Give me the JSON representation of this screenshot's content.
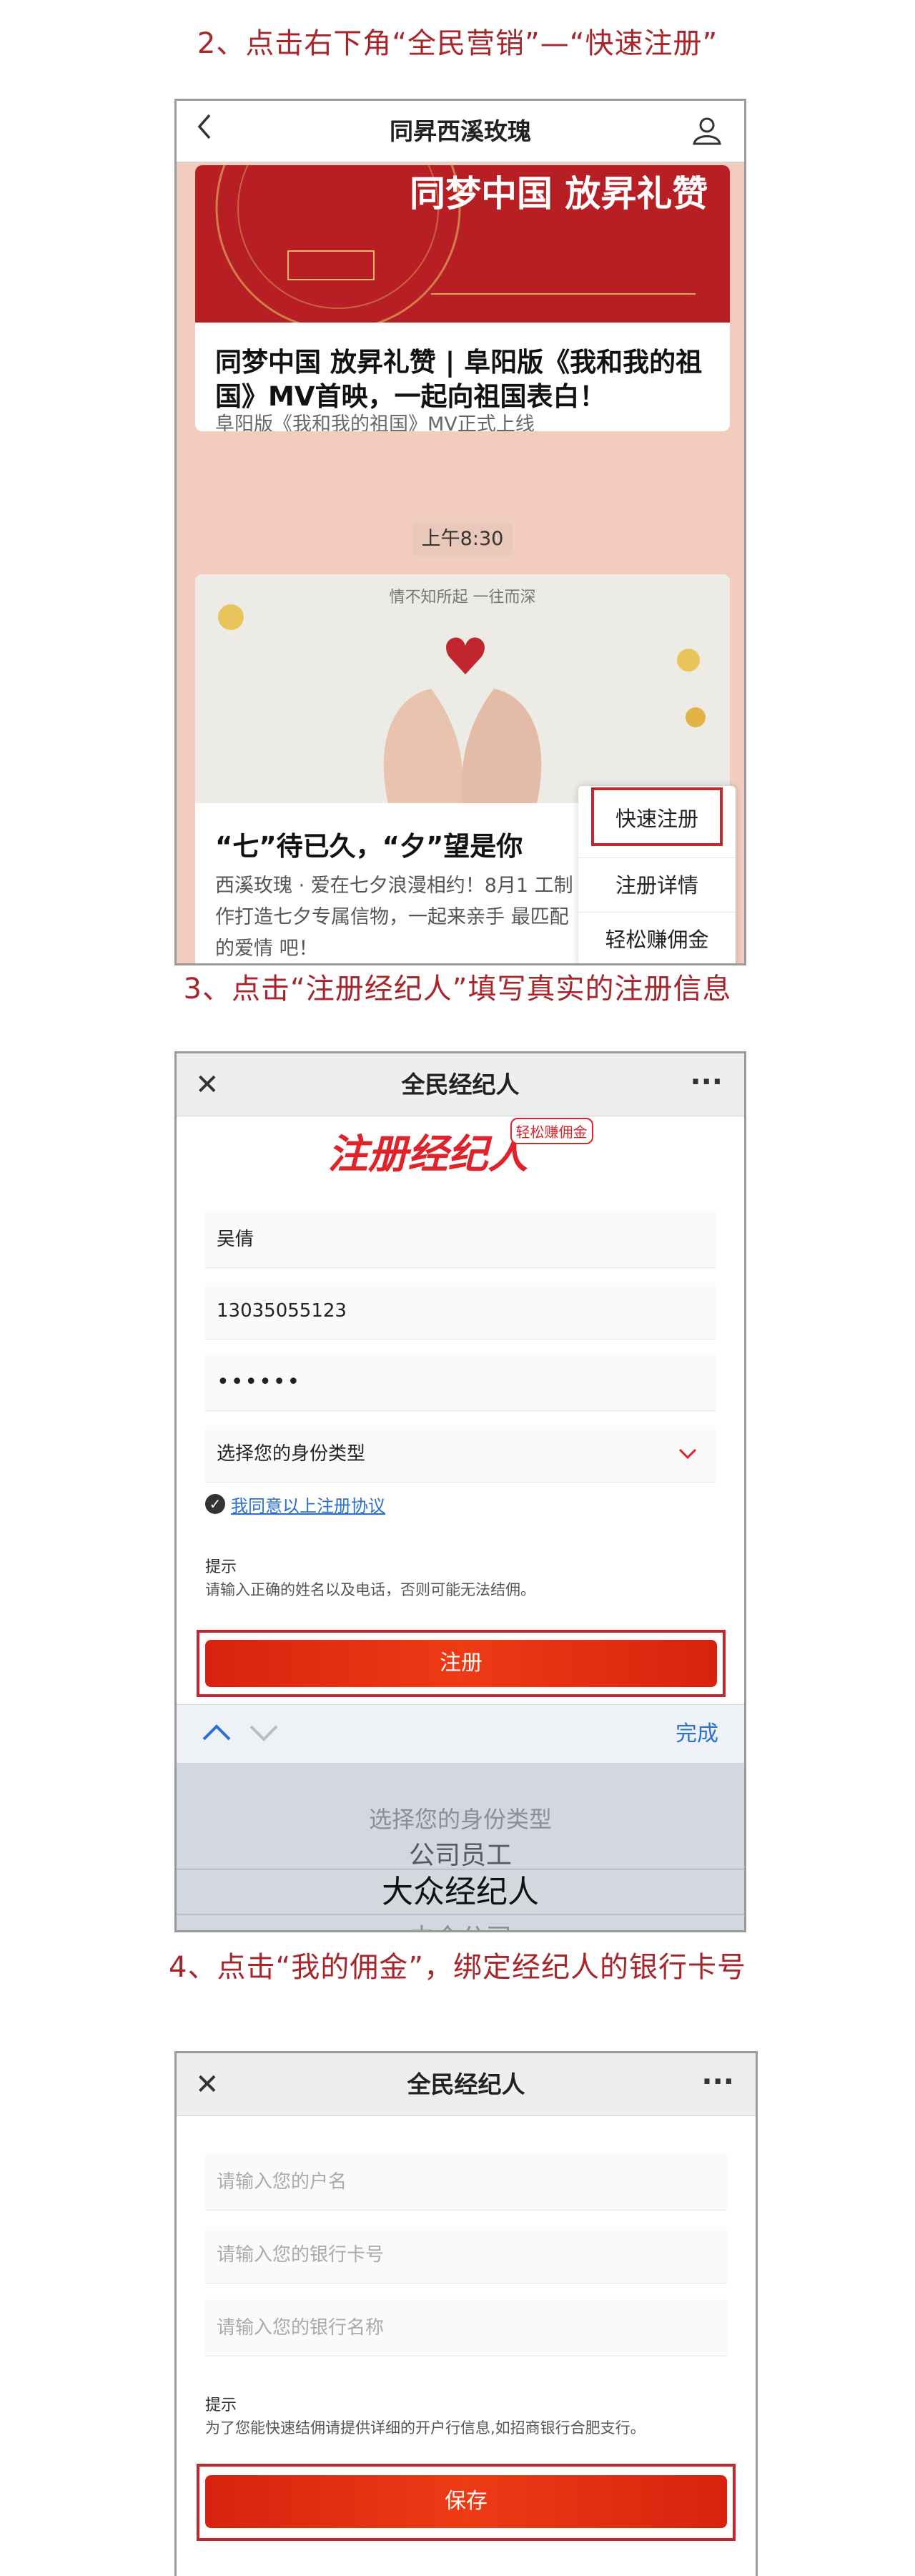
{
  "step2": {
    "title": "2、点击右下角“全民营销”—“快速注册”",
    "header": {
      "back_icon": "chevron-left-icon",
      "title": "同昇西溪玫瑰",
      "profile_icon": "user-icon"
    },
    "banner": {
      "headline": "同梦中国  放昇礼赞"
    },
    "article1": {
      "title": "同梦中国 放昇礼赞 | 阜阳版《我和我的祖国》MV首映，一起向祖国表白！",
      "subtitle": "阜阳版《我和我的祖国》MV正式上线"
    },
    "time_label": "上午8:30",
    "article2": {
      "image_caption": "情不知所起 一往而深",
      "title": "“七”待已久，“夕”望是你",
      "desc": "西溪玫瑰 · 爱在七夕浪漫相约！8月1 工制作打造七夕专属信物，一起来亲手 最匹配的爱情 吧！"
    },
    "popup_menu": [
      "快速注册",
      "注册详情",
      "轻松赚佣金"
    ]
  },
  "step3": {
    "title": "3、点击“注册经纪人”填写真实的注册信息",
    "header": {
      "close_icon": "close-icon",
      "title": "全民经纪人",
      "more_icon": "more-icon"
    },
    "hero": {
      "title": "注册经纪人",
      "tag": "轻松赚佣金"
    },
    "fields": {
      "name": "吴倩",
      "phone": "13035055123",
      "password": "••••••",
      "identity": "选择您的身份类型"
    },
    "agree_text": "我同意以上注册协议",
    "tip_title": "提示",
    "tip_text": "请输入正确的姓名以及电话，否则可能无法结佣。",
    "submit_label": "注册",
    "keyboard": {
      "done_label": "完成"
    },
    "picker": [
      "选择您的身份类型",
      "公司员工",
      "大众经纪人",
      "中介公司"
    ]
  },
  "step4": {
    "title": "4、点击“我的佣金”，绑定经纪人的银行卡号",
    "header": {
      "close_icon": "close-icon",
      "title": "全民经纪人",
      "more_icon": "more-icon"
    },
    "placeholders": {
      "account_name": "请输入您的户名",
      "card_number": "请输入您的银行卡号",
      "bank_name": "请输入您的银行名称"
    },
    "tip_title": "提示",
    "tip_text": "为了您能快速结佣请提供详细的开户行信息,如招商银行合肥支行。",
    "save_label": "保存"
  },
  "colors": {
    "accent_red": "#c3282e",
    "title_red": "#a8262b",
    "button_red": "#e3321a",
    "link_blue": "#2a6fd1"
  }
}
